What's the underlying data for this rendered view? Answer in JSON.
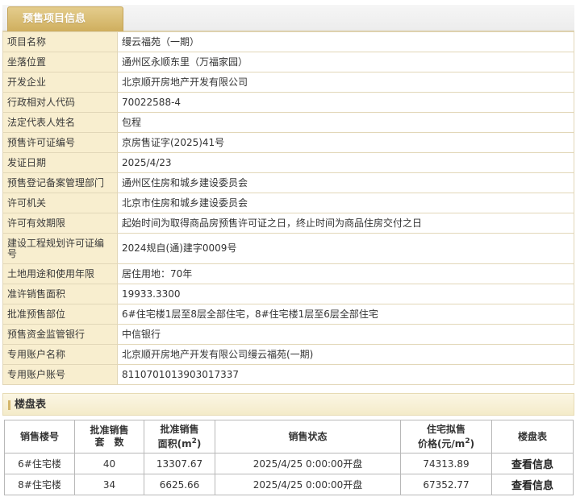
{
  "tab": {
    "label": "预售项目信息"
  },
  "info_rows": [
    {
      "label": "项目名称",
      "value": "缦云福苑（一期）"
    },
    {
      "label": "坐落位置",
      "value": "通州区永顺东里（万福家园）"
    },
    {
      "label": "开发企业",
      "value": "北京顺开房地产开发有限公司"
    },
    {
      "label": "行政相对人代码",
      "value": "70022588-4"
    },
    {
      "label": "法定代表人姓名",
      "value": "包程"
    },
    {
      "label": "预售许可证编号",
      "value": "京房售证字(2025)41号"
    },
    {
      "label": "发证日期",
      "value": "2025/4/23"
    },
    {
      "label": "预售登记备案管理部门",
      "value": "通州区住房和城乡建设委员会"
    },
    {
      "label": "许可机关",
      "value": "北京市住房和城乡建设委员会"
    },
    {
      "label": "许可有效期限",
      "value": "起始时间为取得商品房预售许可证之日，终止时间为商品住房交付之日"
    },
    {
      "label": "建设工程规划许可证编号",
      "value": "2024规自(通)建字0009号"
    },
    {
      "label": "土地用途和使用年限",
      "value": "居住用地：70年"
    },
    {
      "label": "准许销售面积",
      "value": "19933.3300"
    },
    {
      "label": "批准预售部位",
      "value": "6#住宅楼1层至8层全部住宅，8#住宅楼1层至6层全部住宅"
    },
    {
      "label": "预售资金监管银行",
      "value": "中信银行"
    },
    {
      "label": "专用账户名称",
      "value": "北京顺开房地产开发有限公司缦云福苑(一期)"
    },
    {
      "label": "专用账户账号",
      "value": "8110701013903017337"
    }
  ],
  "loupan": {
    "title": "楼盘表",
    "headers": {
      "building": "销售楼号",
      "units_line1": "批准销售",
      "units_line2": "套　数",
      "area_line1": "批准销售",
      "area_line2": "面积(m",
      "area_sup": "2",
      "area_tail": ")",
      "status": "销售状态",
      "price_line1": "住宅拟售",
      "price_line2": "价格(元/m",
      "price_sup": "2",
      "price_tail": ")",
      "table": "楼盘表"
    },
    "rows": [
      {
        "building": "6#住宅楼",
        "units": "40",
        "area": "13307.67",
        "status": "2025/4/25 0:00:00开盘",
        "price": "74313.89",
        "action": "查看信息"
      },
      {
        "building": "8#住宅楼",
        "units": "34",
        "area": "6625.66",
        "status": "2025/4/25 0:00:00开盘",
        "price": "67352.77",
        "action": "查看信息"
      }
    ]
  }
}
